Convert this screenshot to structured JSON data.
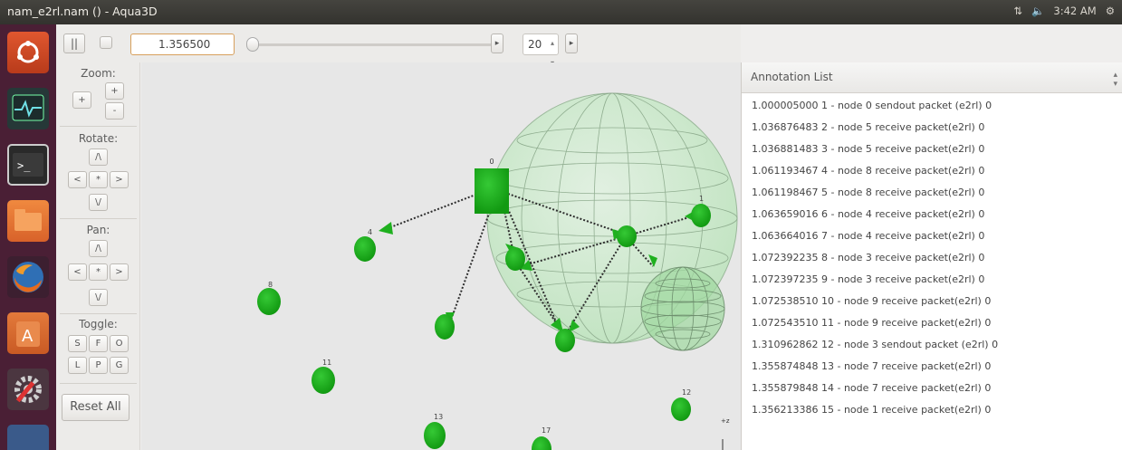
{
  "window": {
    "title": "nam_e2rl.nam () - Aqua3D",
    "clock": "3:42 AM"
  },
  "toolbar": {
    "pause_label": "||",
    "time_value": "1.356500",
    "step_value": "20"
  },
  "controls": {
    "zoom_label": "Zoom:",
    "rotate_label": "Rotate:",
    "pan_label": "Pan:",
    "toggle_label": "Toggle:",
    "zoom_buttons": [
      "+",
      "+",
      "-"
    ],
    "rotate_buttons": [
      "/\\",
      "<",
      "*",
      ">",
      "\\/"
    ],
    "pan_buttons": [
      "/\\",
      "<",
      "*",
      ">",
      "\\/"
    ],
    "toggle_buttons": [
      "S",
      "F",
      "O",
      "L",
      "P",
      "G"
    ],
    "reset_label": "Reset All"
  },
  "scene": {
    "node_color": "#1fa81f",
    "sphere_color": "#b8e6b8",
    "axis_label": "+z",
    "node_labels": [
      "0",
      "1",
      "4",
      "8",
      "11",
      "13",
      "17",
      "12"
    ]
  },
  "annotations": {
    "header": "Annotation List",
    "items": [
      "1.000005000 1 - node 0 sendout packet (e2rl) 0",
      "1.036876483 2 - node 5 receive packet(e2rl) 0",
      "1.036881483 3 - node 5 receive packet(e2rl) 0",
      "1.061193467 4 - node 8 receive packet(e2rl) 0",
      "1.061198467 5 - node 8 receive packet(e2rl) 0",
      "1.063659016 6 - node 4 receive packet(e2rl) 0",
      "1.063664016 7 - node 4 receive packet(e2rl) 0",
      "1.072392235 8 - node 3 receive packet(e2rl) 0",
      "1.072397235 9 - node 3 receive packet(e2rl) 0",
      "1.072538510 10 - node 9 receive packet(e2rl) 0",
      "1.072543510 11 - node 9 receive packet(e2rl) 0",
      "1.310962862 12 - node 3 sendout packet (e2rl) 0",
      "1.355874848 13 - node 7 receive packet(e2rl) 0",
      "1.355879848 14 - node 7 receive packet(e2rl) 0",
      "1.356213386 15 - node 1 receive packet(e2rl) 0"
    ]
  }
}
